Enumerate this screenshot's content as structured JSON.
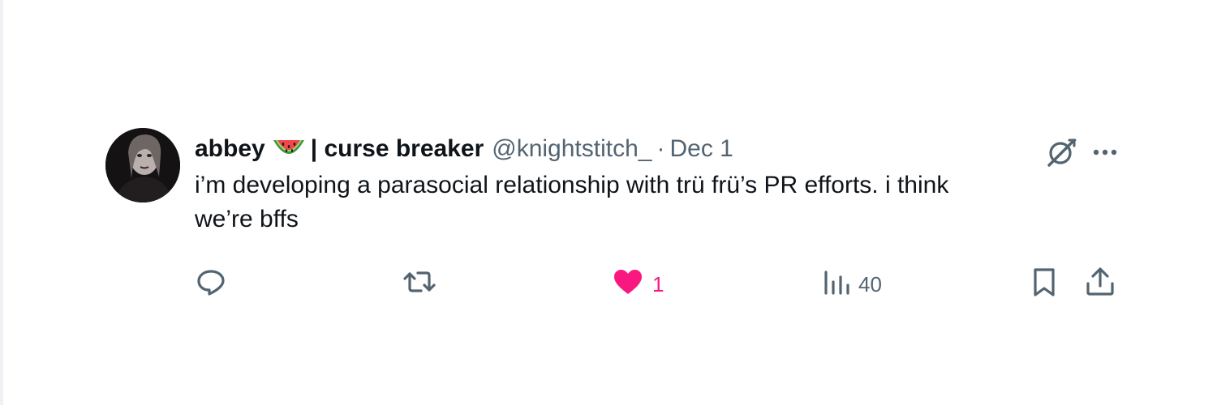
{
  "tweet": {
    "author": {
      "name": "abbey",
      "name_suffix": "| curse breaker",
      "handle": "@knightstitch_",
      "separator": "·",
      "emoji": "watermelon-icon",
      "avatar": "avatar-photo"
    },
    "date": "Dec 1",
    "text_line1": "i’m developing a parasocial relationship with trü frü’s PR efforts. i think",
    "text_line2": "we’re bffs",
    "top_icons": [
      "grok-icon",
      "more-icon"
    ],
    "actions": {
      "reply": {
        "icon": "reply-icon",
        "count": ""
      },
      "repost": {
        "icon": "repost-icon",
        "count": ""
      },
      "like": {
        "icon": "heart-icon",
        "count": "1",
        "active": true,
        "color": "#f91880"
      },
      "views": {
        "icon": "views-icon",
        "count": "40"
      },
      "bookmark": {
        "icon": "bookmark-icon"
      },
      "share": {
        "icon": "share-icon"
      }
    }
  },
  "colors": {
    "text_primary": "#0f1419",
    "text_secondary": "#536471",
    "like": "#f91880",
    "border": "#eff1f5"
  }
}
